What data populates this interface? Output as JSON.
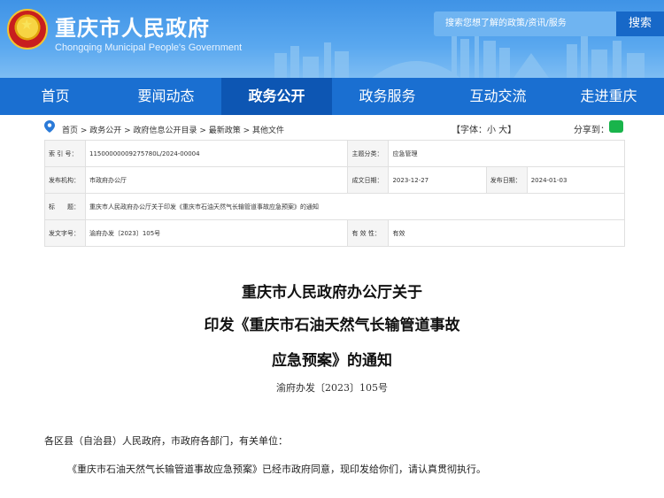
{
  "header": {
    "title": "重庆市人民政府",
    "subtitle": "Chongqing Municipal People's Government",
    "search_placeholder": "搜索您想了解的政策/资讯/服务",
    "search_button": "搜索"
  },
  "nav": [
    "首页",
    "要闻动态",
    "政务公开",
    "政务服务",
    "互动交流",
    "走进重庆"
  ],
  "breadcrumb": "首页 > 政务公开 > 政府信息公开目录 > 最新政策 > 其他文件",
  "font_size_label": "【字体：小 大】",
  "share_label": "分享到：",
  "meta": {
    "index_label": "索 引 号：",
    "index_value": "11500000009275780L/2024-00004",
    "topic_label": "主题分类：",
    "topic_value": "应急管理",
    "issuer_label": "发布机构：",
    "issuer_value": "市政府办公厅",
    "created_label": "成文日期：",
    "created_value": "2023-12-27",
    "published_label": "发布日期：",
    "published_value": "2024-01-03",
    "title_label": "标　　题：",
    "title_value": "重庆市人民政府办公厅关于印发《重庆市石油天然气长输管道事故应急预案》的通知",
    "docno_label": "发文字号：",
    "docno_value": "渝府办发〔2023〕105号",
    "valid_label": "有 效 性：",
    "valid_value": "有效"
  },
  "doc": {
    "title_line1": "重庆市人民政府办公厅关于",
    "title_line2": "印发《重庆市石油天然气长输管道事故",
    "title_line3": "应急预案》的通知",
    "number": "渝府办发〔2023〕105号",
    "salutation": "各区县（自治县）人民政府，市政府各部门，有关单位：",
    "body": "《重庆市石油天然气长输管道事故应急预案》已经市政府同意，现印发给你们，请认真贯彻执行。"
  },
  "colors": {
    "nav": "#1a6fd1",
    "nav_active": "#0d56b3",
    "header": "#3f93e6"
  }
}
